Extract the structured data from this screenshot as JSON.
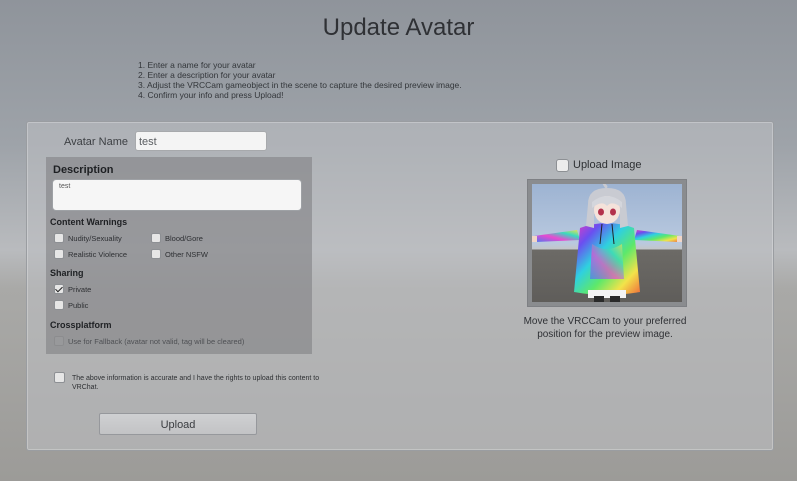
{
  "title": "Update Avatar",
  "instructions": [
    "1. Enter a name for your avatar",
    "2. Enter a description for your avatar",
    "3. Adjust the VRCCam gameobject in the scene to capture the desired preview image.",
    "4. Confirm your info and press Upload!"
  ],
  "avatar_name": {
    "label": "Avatar Name",
    "value": "test"
  },
  "description": {
    "label": "Description",
    "value": "test"
  },
  "content_warnings": {
    "label": "Content Warnings",
    "items": [
      {
        "label": "Nudity/Sexuality",
        "checked": false
      },
      {
        "label": "Blood/Gore",
        "checked": false
      },
      {
        "label": "Realistic Violence",
        "checked": false
      },
      {
        "label": "Other NSFW",
        "checked": false
      }
    ]
  },
  "sharing": {
    "label": "Sharing",
    "options": [
      {
        "label": "Private",
        "checked": true
      },
      {
        "label": "Public",
        "checked": false
      }
    ]
  },
  "crossplatform": {
    "label": "Crossplatform",
    "fallback_label": "Use for Fallback (avatar not valid, tag will be cleared)",
    "fallback_disabled": true
  },
  "agreement": {
    "text": "The above information is accurate and I have the rights to upload this content to VRChat.",
    "checked": false
  },
  "upload_button": "Upload",
  "upload_image": {
    "label": "Upload Image",
    "checked": false
  },
  "preview_caption": "Move the VRCCam to your preferred position for the preview image.",
  "colors": {
    "background": "#9ea3a9",
    "panel": "#bfc1c4",
    "form_box": "#808183",
    "text_dark": "#2f3135"
  }
}
